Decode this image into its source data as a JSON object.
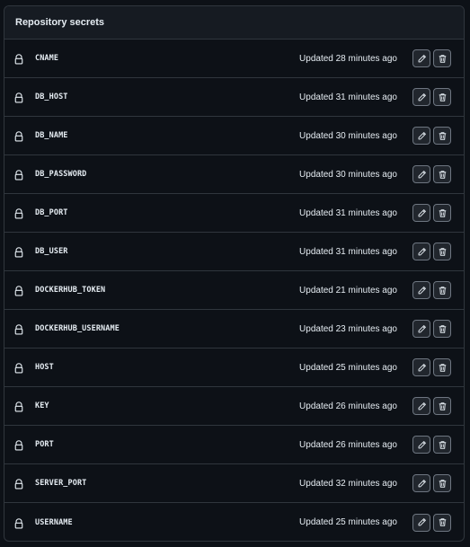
{
  "panel": {
    "title": "Repository secrets"
  },
  "icons": {
    "lock": "lock-icon",
    "edit": "pencil-icon",
    "delete": "trash-icon"
  },
  "colors": {
    "background": "#0d1117",
    "header_bg": "#161b22",
    "border": "#30363d",
    "text": "#e6edf3"
  },
  "secrets": [
    {
      "name": "CNAME",
      "updated": "Updated 28 minutes ago"
    },
    {
      "name": "DB_HOST",
      "updated": "Updated 31 minutes ago"
    },
    {
      "name": "DB_NAME",
      "updated": "Updated 30 minutes ago"
    },
    {
      "name": "DB_PASSWORD",
      "updated": "Updated 30 minutes ago"
    },
    {
      "name": "DB_PORT",
      "updated": "Updated 31 minutes ago"
    },
    {
      "name": "DB_USER",
      "updated": "Updated 31 minutes ago"
    },
    {
      "name": "DOCKERHUB_TOKEN",
      "updated": "Updated 21 minutes ago"
    },
    {
      "name": "DOCKERHUB_USERNAME",
      "updated": "Updated 23 minutes ago"
    },
    {
      "name": "HOST",
      "updated": "Updated 25 minutes ago"
    },
    {
      "name": "KEY",
      "updated": "Updated 26 minutes ago"
    },
    {
      "name": "PORT",
      "updated": "Updated 26 minutes ago"
    },
    {
      "name": "SERVER_PORT",
      "updated": "Updated 32 minutes ago"
    },
    {
      "name": "USERNAME",
      "updated": "Updated 25 minutes ago"
    }
  ]
}
